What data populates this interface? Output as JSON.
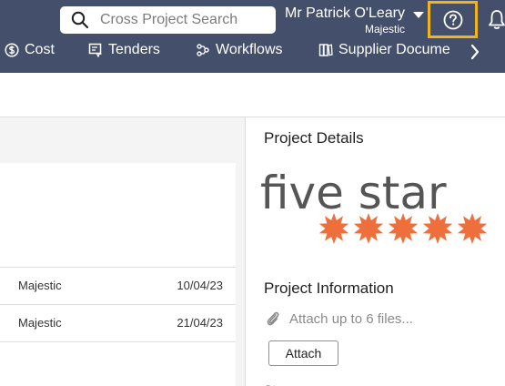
{
  "search": {
    "placeholder": "Cross Project Search",
    "icon": "search-icon"
  },
  "user": {
    "name": "Mr Patrick O'Leary",
    "organisation": "Majestic"
  },
  "header": {
    "help_icon": "help-circle-icon",
    "bell_icon": "bell-icon",
    "highlight_color": "#f2b418",
    "bar_color": "#44506b"
  },
  "nav": {
    "items": [
      {
        "label": "Cost",
        "icon": "dollar-circle-icon"
      },
      {
        "label": "Tenders",
        "icon": "tender-icon"
      },
      {
        "label": "Workflows",
        "icon": "workflow-icon"
      },
      {
        "label": "Supplier Docume",
        "icon": "documents-icon"
      }
    ],
    "next_icon": "chevron-right-icon"
  },
  "table": {
    "rows": [
      {
        "company": "Majestic",
        "date": "10/04/23"
      },
      {
        "company": "Majestic",
        "date": "21/04/23"
      }
    ]
  },
  "details": {
    "title": "Project Details",
    "logo": {
      "text": "five star",
      "star_color": "#ee6f3c",
      "star_count": 5
    },
    "info_title": "Project Information",
    "attach_hint": "Attach up to 6 files...",
    "attach_button": "Attach",
    "next_label_fragment": "St"
  }
}
